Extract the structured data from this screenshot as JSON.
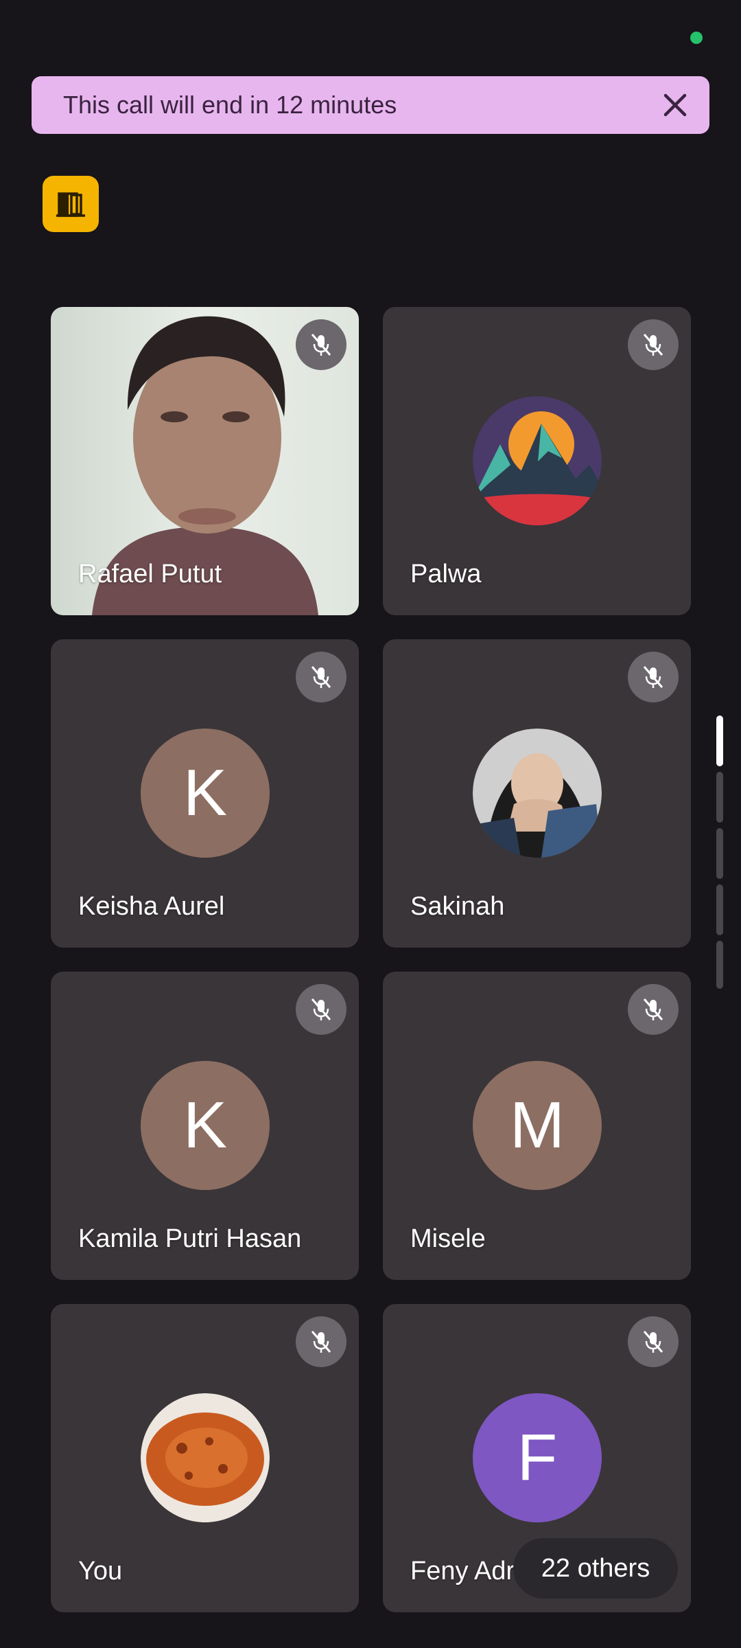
{
  "banner": {
    "text": "This call will end in 12 minutes",
    "close_icon": "close-icon"
  },
  "room_button": {
    "icon": "door-icon",
    "color": "#f4b400"
  },
  "participants": [
    {
      "name": "Rafael Putut",
      "type": "video",
      "muted": true
    },
    {
      "name": "Palwa",
      "type": "image-avatar",
      "muted": true
    },
    {
      "name": "Keisha Aurel",
      "type": "initial",
      "initial": "K",
      "color": "#8c6e63",
      "muted": true
    },
    {
      "name": "Sakinah",
      "type": "image-avatar",
      "muted": true
    },
    {
      "name": "Kamila Putri Hasan",
      "type": "initial",
      "initial": "K",
      "color": "#8c6e63",
      "muted": true
    },
    {
      "name": "Misele",
      "type": "initial",
      "initial": "M",
      "color": "#8c6e63",
      "muted": true
    },
    {
      "name": "You",
      "type": "image-avatar",
      "muted": true
    },
    {
      "name": "Feny Adri",
      "type": "initial",
      "initial": "F",
      "color": "#7e57c2",
      "muted": true
    }
  ],
  "others": {
    "label": "22 others"
  },
  "status": {
    "connection_color": "#25c26b"
  }
}
